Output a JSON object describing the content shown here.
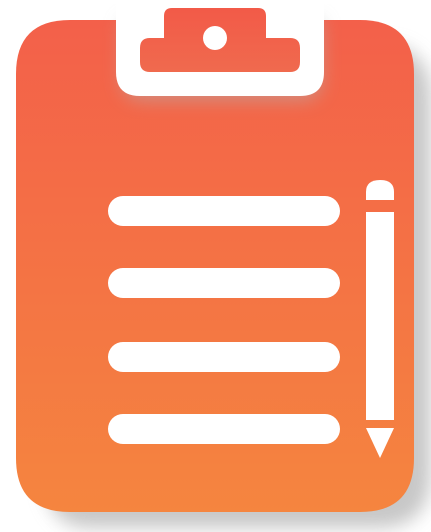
{
  "icon": {
    "name": "clipboard-with-pencil-icon",
    "parts": [
      "clipboard-board",
      "clipboard-clip",
      "text-lines",
      "pencil"
    ],
    "line_count": 4
  },
  "colors": {
    "background": "#ffffff",
    "board_top": "#f3604a",
    "board_bottom": "#f5853f",
    "clip_top": "#f25a48",
    "clip_bottom": "#f06a4e",
    "glyph": "#ffffff",
    "shadow": "#9a9a9a"
  }
}
